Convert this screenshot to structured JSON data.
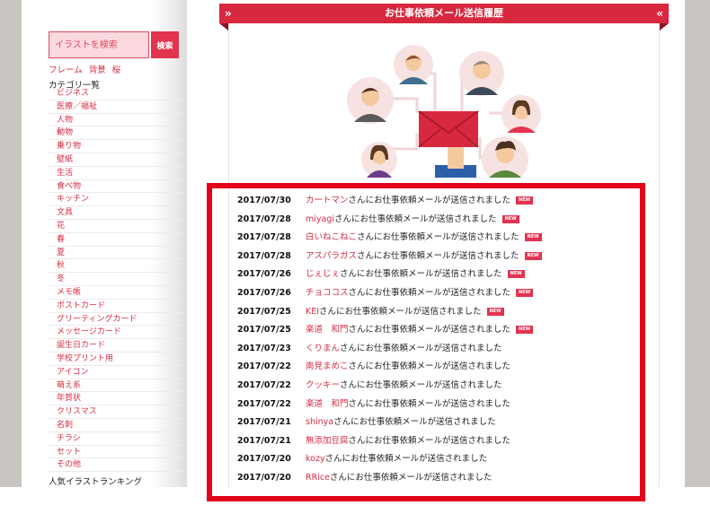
{
  "sidebar": {
    "search_placeholder": "イラストを検索",
    "search_button": "検索",
    "frame_links": [
      "フレーム",
      "背景",
      "桜"
    ],
    "category_title": "カテゴリ一覧",
    "categories": [
      "ビジネス",
      "医療／福祉",
      "人物",
      "動物",
      "乗り物",
      "壁紙",
      "生活",
      "食べ物",
      "キッチン",
      "文具",
      "花",
      "春",
      "夏",
      "秋",
      "冬",
      "メモ帳",
      "ポストカード",
      "グリーティングカード",
      "メッセージカード",
      "誕生日カード",
      "学校プリント用",
      "アイコン",
      "萌え系",
      "年賀状",
      "クリスマス",
      "名刺",
      "チラシ",
      "セット",
      "その他"
    ],
    "ranking_title": "人気イラストランキング"
  },
  "header": {
    "title": "お仕事依頼メール送信履歴",
    "left_chevron": "»",
    "right_chevron": "«"
  },
  "history": {
    "message": "さんにお仕事依頼メールが送信されました",
    "new_label": "NEW",
    "rows": [
      {
        "date": "2017/07/30",
        "user": "カートマン",
        "new": true
      },
      {
        "date": "2017/07/28",
        "user": "miyagi",
        "new": true
      },
      {
        "date": "2017/07/28",
        "user": "白いねこねこ",
        "new": true
      },
      {
        "date": "2017/07/28",
        "user": "アスパラガス",
        "new": true
      },
      {
        "date": "2017/07/26",
        "user": "じぇじぇ",
        "new": true
      },
      {
        "date": "2017/07/26",
        "user": "チョココス",
        "new": true
      },
      {
        "date": "2017/07/25",
        "user": "KEI",
        "new": true
      },
      {
        "date": "2017/07/25",
        "user": "楽道　和門",
        "new": true
      },
      {
        "date": "2017/07/23",
        "user": "くりまん",
        "new": false
      },
      {
        "date": "2017/07/22",
        "user": "南見まめこ",
        "new": false
      },
      {
        "date": "2017/07/22",
        "user": "クッキー",
        "new": false
      },
      {
        "date": "2017/07/22",
        "user": "楽道　和門",
        "new": false
      },
      {
        "date": "2017/07/21",
        "user": "shinya",
        "new": false
      },
      {
        "date": "2017/07/21",
        "user": "無添加豆腐",
        "new": false
      },
      {
        "date": "2017/07/20",
        "user": "kozy",
        "new": false
      },
      {
        "date": "2017/07/20",
        "user": "RRice",
        "new": false
      }
    ]
  },
  "colors": {
    "accent": "#d8283f",
    "highlight": "#e2001a",
    "link": "#d62d45",
    "background_gray": "#c9c6c1"
  },
  "icons": {
    "illustration": "people-network-envelope-illustration"
  }
}
